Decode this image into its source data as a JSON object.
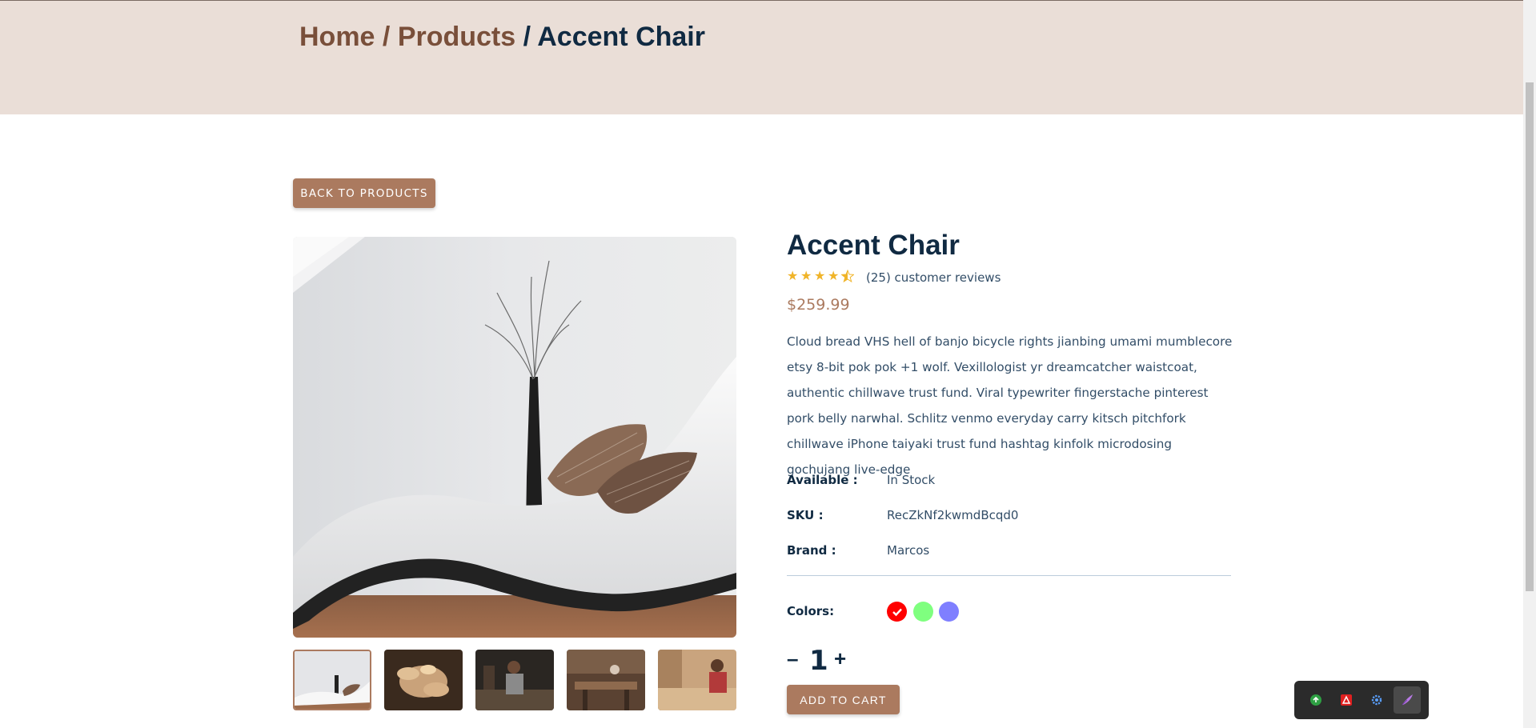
{
  "breadcrumb": {
    "home": "Home",
    "sep1": " / ",
    "products": "Products",
    "sep2": " / ",
    "current": "Accent Chair"
  },
  "back_button": "BACK TO PRODUCTS",
  "product": {
    "title": "Accent Chair",
    "rating": 4.5,
    "reviews": "(25) customer reviews",
    "price": "$259.99",
    "description": "Cloud bread VHS hell of banjo bicycle rights jianbing umami mumblecore etsy 8-bit pok pok +1 wolf. Vexillologist yr dreamcatcher waistcoat, authentic chillwave trust fund. Viral typewriter fingerstache pinterest pork belly narwhal. Schlitz venmo everyday carry kitsch pitchfork chillwave iPhone taiyaki trust fund hashtag kinfolk microdosing gochujang live-edge",
    "meta": [
      {
        "label": "Available :",
        "value": "In Stock"
      },
      {
        "label": "SKU :",
        "value": "RecZkNf2kwmdBcqd0"
      },
      {
        "label": "Brand :",
        "value": "Marcos"
      }
    ],
    "colors_label": "Colors:",
    "colors": [
      "#ff0000",
      "#00ff00",
      "#0000ff"
    ],
    "selected_color": "#ff0000",
    "quantity": "1",
    "minus": "–",
    "plus": "+",
    "add_to_cart": "ADD TO CART"
  },
  "images": {
    "main": "white chaise lounge with vase and pillows",
    "thumbnails": [
      "white chaise lounge",
      "wood shavings",
      "carpenter at workbench",
      "woodworking workshop",
      "woman sanding wood"
    ]
  },
  "extension_tray": [
    "green-extension-icon",
    "pdf-icon",
    "gear-icon",
    "feather-icon"
  ]
}
